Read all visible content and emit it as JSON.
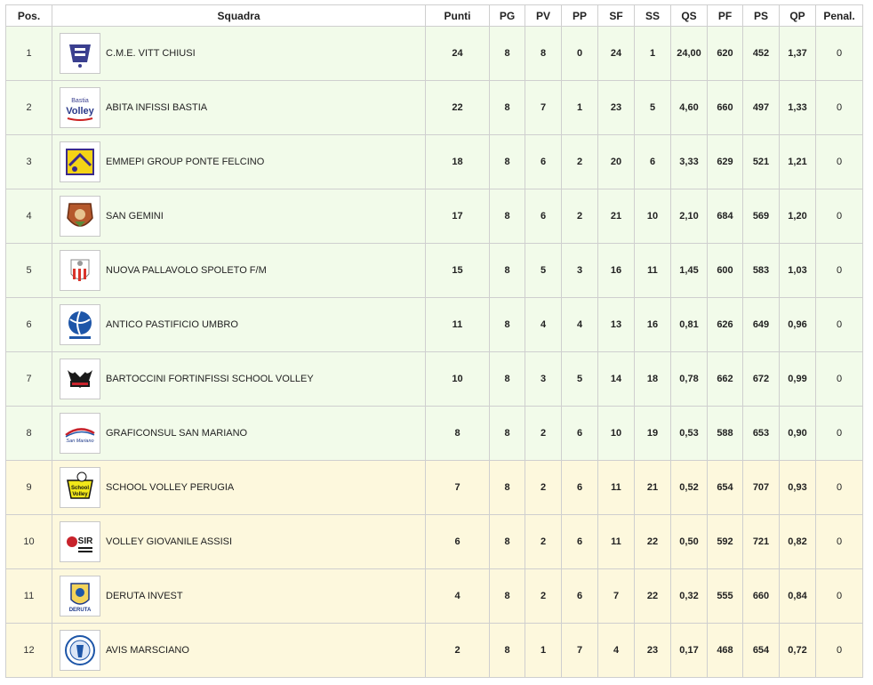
{
  "headers": {
    "pos": "Pos.",
    "squadra": "Squadra",
    "punti": "Punti",
    "pg": "PG",
    "pv": "PV",
    "pp": "PP",
    "sf": "SF",
    "ss": "SS",
    "qs": "QS",
    "pf": "PF",
    "ps": "PS",
    "qp": "QP",
    "penal": "Penal."
  },
  "colors": {
    "zone_green": "#f2fbea",
    "zone_yellow": "#fdf8dd",
    "border": "#cfcfcf"
  },
  "rows": [
    {
      "pos": "1",
      "team": "C.M.E. VITT CHIUSI",
      "logo": "chiusi-logo",
      "punti": "24",
      "pg": "8",
      "pv": "8",
      "pp": "0",
      "sf": "24",
      "ss": "1",
      "qs": "24,00",
      "pf": "620",
      "ps": "452",
      "qp": "1,37",
      "penal": "0",
      "zone": "green"
    },
    {
      "pos": "2",
      "team": "ABITA INFISSI BASTIA",
      "logo": "bastia-volley-logo",
      "logo_text": [
        "Bastia",
        "Volley"
      ],
      "punti": "22",
      "pg": "8",
      "pv": "7",
      "pp": "1",
      "sf": "23",
      "ss": "5",
      "qs": "4,60",
      "pf": "660",
      "ps": "497",
      "qp": "1,33",
      "penal": "0",
      "zone": "green"
    },
    {
      "pos": "3",
      "team": "EMMEPI GROUP PONTE FELCINO",
      "logo": "ponte-felcino-logo",
      "punti": "18",
      "pg": "8",
      "pv": "6",
      "pp": "2",
      "sf": "20",
      "ss": "6",
      "qs": "3,33",
      "pf": "629",
      "ps": "521",
      "qp": "1,21",
      "penal": "0",
      "zone": "green"
    },
    {
      "pos": "4",
      "team": "SAN GEMINI",
      "logo": "san-gemini-logo",
      "punti": "17",
      "pg": "8",
      "pv": "6",
      "pp": "2",
      "sf": "21",
      "ss": "10",
      "qs": "2,10",
      "pf": "684",
      "ps": "569",
      "qp": "1,20",
      "penal": "0",
      "zone": "green"
    },
    {
      "pos": "5",
      "team": "NUOVA PALLAVOLO SPOLETO F/M",
      "logo": "spoleto-logo",
      "punti": "15",
      "pg": "8",
      "pv": "5",
      "pp": "3",
      "sf": "16",
      "ss": "11",
      "qs": "1,45",
      "pf": "600",
      "ps": "583",
      "qp": "1,03",
      "penal": "0",
      "zone": "green"
    },
    {
      "pos": "6",
      "team": "ANTICO PASTIFICIO UMBRO",
      "logo": "volleyball-logo",
      "punti": "11",
      "pg": "8",
      "pv": "4",
      "pp": "4",
      "sf": "13",
      "ss": "16",
      "qs": "0,81",
      "pf": "626",
      "ps": "649",
      "qp": "0,96",
      "penal": "0",
      "zone": "green"
    },
    {
      "pos": "7",
      "team": "BARTOCCINI FORTINFISSI SCHOOL VOLLEY",
      "logo": "black-bulls-logo",
      "punti": "10",
      "pg": "8",
      "pv": "3",
      "pp": "5",
      "sf": "14",
      "ss": "18",
      "qs": "0,78",
      "pf": "662",
      "ps": "672",
      "qp": "0,99",
      "penal": "0",
      "zone": "green"
    },
    {
      "pos": "8",
      "team": "GRAFICONSUL SAN MARIANO",
      "logo": "san-mariano-logo",
      "logo_text": [
        "San Mariano"
      ],
      "punti": "8",
      "pg": "8",
      "pv": "2",
      "pp": "6",
      "sf": "10",
      "ss": "19",
      "qs": "0,53",
      "pf": "588",
      "ps": "653",
      "qp": "0,90",
      "penal": "0",
      "zone": "green"
    },
    {
      "pos": "9",
      "team": "SCHOOL VOLLEY PERUGIA",
      "logo": "school-volley-logo",
      "logo_text": [
        "School",
        "Volley"
      ],
      "punti": "7",
      "pg": "8",
      "pv": "2",
      "pp": "6",
      "sf": "11",
      "ss": "21",
      "qs": "0,52",
      "pf": "654",
      "ps": "707",
      "qp": "0,93",
      "penal": "0",
      "zone": "yellow"
    },
    {
      "pos": "10",
      "team": "VOLLEY GIOVANILE ASSISI",
      "logo": "sir-safety-logo",
      "logo_text": [
        "SIR"
      ],
      "punti": "6",
      "pg": "8",
      "pv": "2",
      "pp": "6",
      "sf": "11",
      "ss": "22",
      "qs": "0,50",
      "pf": "592",
      "ps": "721",
      "qp": "0,82",
      "penal": "0",
      "zone": "yellow"
    },
    {
      "pos": "11",
      "team": "DERUTA INVEST",
      "logo": "deruta-logo",
      "logo_text": [
        "DERUTA"
      ],
      "punti": "4",
      "pg": "8",
      "pv": "2",
      "pp": "6",
      "sf": "7",
      "ss": "22",
      "qs": "0,32",
      "pf": "555",
      "ps": "660",
      "qp": "0,84",
      "penal": "0",
      "zone": "yellow"
    },
    {
      "pos": "12",
      "team": "AVIS MARSCIANO",
      "logo": "avis-marsciano-logo",
      "punti": "2",
      "pg": "8",
      "pv": "1",
      "pp": "7",
      "sf": "4",
      "ss": "23",
      "qs": "0,17",
      "pf": "468",
      "ps": "654",
      "qp": "0,72",
      "penal": "0",
      "zone": "yellow"
    }
  ]
}
